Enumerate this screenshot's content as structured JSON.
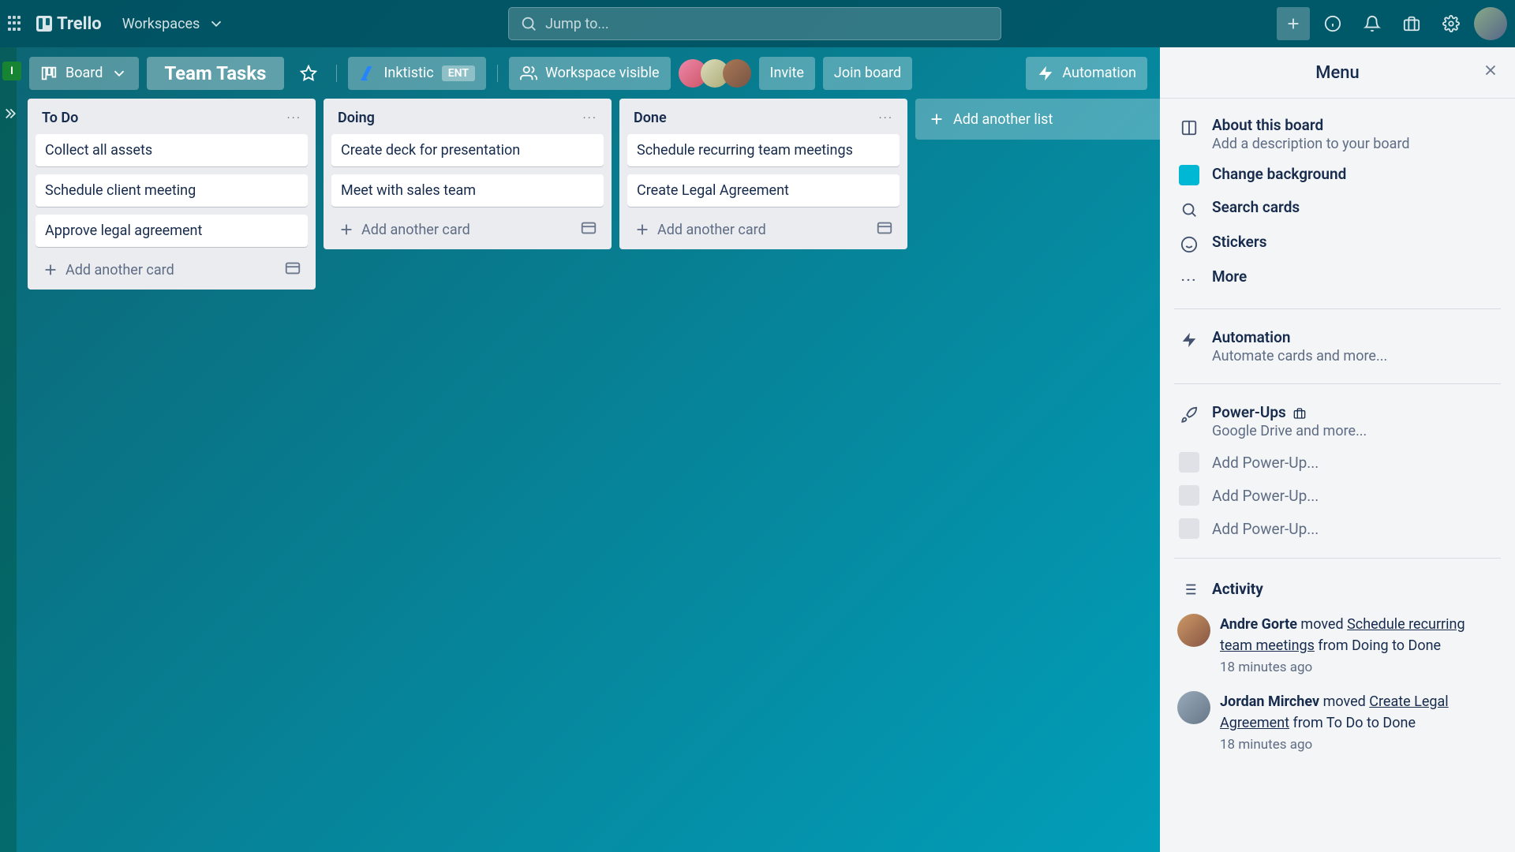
{
  "topbar": {
    "logo": "Trello",
    "workspaces": "Workspaces",
    "search_placeholder": "Jump to..."
  },
  "board_header": {
    "view_label": "Board",
    "title": "Team Tasks",
    "org": "Inktistic",
    "org_badge": "ENT",
    "visibility": "Workspace visible",
    "invite": "Invite",
    "join": "Join board",
    "automation": "Automation"
  },
  "lists": [
    {
      "title": "To Do",
      "cards": [
        "Collect all assets",
        "Schedule client meeting",
        "Approve legal agreement"
      ],
      "add_label": "Add another card"
    },
    {
      "title": "Doing",
      "cards": [
        "Create deck for presentation",
        "Meet with sales team"
      ],
      "add_label": "Add another card"
    },
    {
      "title": "Done",
      "cards": [
        "Schedule recurring team meetings",
        "Create Legal Agreement"
      ],
      "add_label": "Add another card"
    }
  ],
  "add_list": "Add another list",
  "sidebar_badge": "I",
  "menu": {
    "title": "Menu",
    "about_title": "About this board",
    "about_sub": "Add a description to your board",
    "change_bg": "Change background",
    "search_cards": "Search cards",
    "stickers": "Stickers",
    "more": "More",
    "auto_title": "Automation",
    "auto_sub": "Automate cards and more...",
    "powerups_title": "Power-Ups",
    "powerups_sub": "Google Drive and more...",
    "add_powerup": "Add Power-Up...",
    "activity_title": "Activity",
    "activity": [
      {
        "user": "Andre Gorte",
        "action": " moved ",
        "link": "Schedule recurring team meetings",
        "tail": " from Doing to Done",
        "time": "18 minutes ago"
      },
      {
        "user": "Jordan Mirchev",
        "action": " moved ",
        "link": "Create Legal Agreement",
        "tail": " from To Do to Done",
        "time": "18 minutes ago"
      }
    ]
  }
}
